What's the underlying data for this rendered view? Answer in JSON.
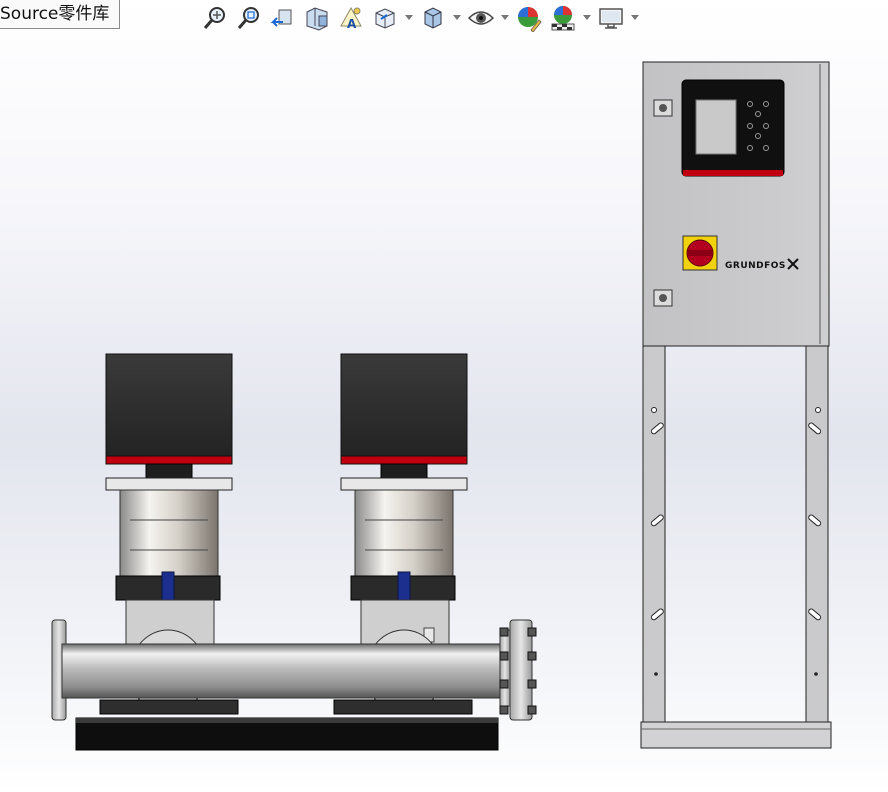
{
  "tab": {
    "label": "Source零件库",
    "partial_prefix": "S"
  },
  "toolbar": {
    "buttons": [
      {
        "name": "zoom-to-fit-icon"
      },
      {
        "name": "zoom-to-area-icon"
      },
      {
        "name": "previous-view-icon"
      },
      {
        "name": "section-view-icon"
      },
      {
        "name": "dynamic-annotation-icon"
      },
      {
        "name": "view-orientation-icon",
        "dropdown": true
      },
      {
        "name": "display-style-icon",
        "dropdown": true
      },
      {
        "name": "hide-show-items-icon",
        "dropdown": true
      },
      {
        "name": "edit-appearance-icon"
      },
      {
        "name": "apply-scene-icon",
        "dropdown": true
      },
      {
        "name": "view-settings-icon",
        "dropdown": true
      }
    ]
  },
  "model": {
    "brand_text": "GRUNDFOS",
    "colors": {
      "motor": "#2b2b2b",
      "accent_red": "#c00010",
      "cabinet": "#c7c7c9",
      "valve_blue": "#1c2f8f"
    }
  }
}
